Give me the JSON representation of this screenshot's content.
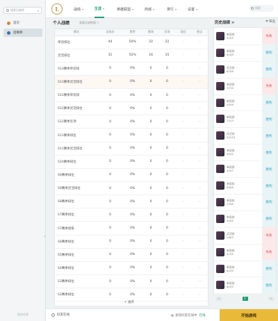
{
  "sidebar": {
    "search_placeholder": "搜索召唤师",
    "items": [
      {
        "label": "首页",
        "icon": "home-icon",
        "color": "#d4843b"
      },
      {
        "label": "召唤师",
        "icon": "user-icon",
        "color": "#3a6fb0"
      }
    ],
    "footer": "版本信息"
  },
  "nav": {
    "items": [
      {
        "label": "战绩",
        "active": false,
        "dropdown": true
      },
      {
        "label": "生涯",
        "active": true,
        "dropdown": true
      },
      {
        "label": "英雄联盟",
        "active": false,
        "dropdown": true
      },
      {
        "label": "商城",
        "active": false,
        "dropdown": true
      },
      {
        "label": "排行",
        "active": false,
        "dropdown": true
      },
      {
        "label": "设置",
        "active": false,
        "dropdown": true
      }
    ],
    "search_placeholder": "搜索"
  },
  "stats": {
    "title": "个人战绩",
    "subtitle": "查看全部数据 >",
    "columns": [
      "模式",
      "总场次",
      "胜率",
      "胜场",
      "负场",
      "段位",
      "胜点"
    ],
    "rows": [
      {
        "name": "单双排位",
        "games": "44",
        "winrate": "50%",
        "wins": "22",
        "losses": "22",
        "tier": "—",
        "lp": "—"
      },
      {
        "name": "灵活排位",
        "games": "31",
        "winrate": "52%",
        "wins": "16",
        "losses": "15",
        "tier": "—",
        "lp": "—"
      },
      {
        "name": "S13赛季单双排",
        "games": "0",
        "winrate": "0%",
        "wins": "0",
        "losses": "0",
        "tier": "—",
        "lp": "—"
      },
      {
        "name": "S13赛季灵活排位",
        "games": "0",
        "winrate": "0%",
        "wins": "0",
        "losses": "0",
        "tier": "—",
        "lp": "—"
      },
      {
        "name": "S12赛季单双排",
        "games": "0",
        "winrate": "0%",
        "wins": "0",
        "losses": "0",
        "tier": "—",
        "lp": "—"
      },
      {
        "name": "S12赛季灵活排位",
        "games": "0",
        "winrate": "0%",
        "wins": "0",
        "losses": "0",
        "tier": "—",
        "lp": "—"
      },
      {
        "name": "S12赛季云顶",
        "games": "0",
        "winrate": "0%",
        "wins": "0",
        "losses": "0",
        "tier": "—",
        "lp": "—"
      },
      {
        "name": "S11赛季排位",
        "games": "0",
        "winrate": "0%",
        "wins": "0",
        "losses": "0",
        "tier": "—",
        "lp": "—"
      },
      {
        "name": "S11赛季灵活排位",
        "games": "0",
        "winrate": "0%",
        "wins": "0",
        "losses": "0",
        "tier": "—",
        "lp": "—"
      },
      {
        "name": "S10赛季排位",
        "games": "0",
        "winrate": "0%",
        "wins": "0",
        "losses": "0",
        "tier": "—",
        "lp": "—"
      },
      {
        "name": "S9赛季排位",
        "games": "0",
        "winrate": "0%",
        "wins": "0",
        "losses": "0",
        "tier": "—",
        "lp": "—"
      },
      {
        "name": "S9赛季灵活排位",
        "games": "0",
        "winrate": "0%",
        "wins": "0",
        "losses": "0",
        "tier": "—",
        "lp": "—"
      },
      {
        "name": "S8赛季排位",
        "games": "0",
        "winrate": "0%",
        "wins": "0",
        "losses": "0",
        "tier": "—",
        "lp": "—"
      },
      {
        "name": "S7赛季排位",
        "games": "0",
        "winrate": "0%",
        "wins": "0",
        "losses": "0",
        "tier": "—",
        "lp": "—"
      },
      {
        "name": "S7赛季组排",
        "games": "0",
        "winrate": "0%",
        "wins": "0",
        "losses": "0",
        "tier": "—",
        "lp": "—"
      },
      {
        "name": "S6赛季排位",
        "games": "0",
        "winrate": "0%",
        "wins": "0",
        "losses": "0",
        "tier": "—",
        "lp": "—"
      },
      {
        "name": "S5赛季排位",
        "games": "0",
        "winrate": "0%",
        "wins": "0",
        "losses": "0",
        "tier": "—",
        "lp": "—"
      },
      {
        "name": "S4赛季排位",
        "games": "0",
        "winrate": "0%",
        "wins": "0",
        "losses": "0",
        "tier": "—",
        "lp": "—"
      },
      {
        "name": "S3赛季排位",
        "games": "0",
        "winrate": "0%",
        "wins": "0",
        "losses": "0",
        "tier": "—",
        "lp": "—"
      },
      {
        "name": "S2赛季排位",
        "games": "0",
        "winrate": "0%",
        "wins": "0",
        "losses": "0",
        "tier": "—",
        "lp": "—"
      }
    ],
    "more_label": "+ 展开"
  },
  "history": {
    "title": "历史战绩 >",
    "filter_label": "筛选",
    "matches": [
      {
        "mode": "单双排",
        "kda": "3/2/5",
        "result": "失败",
        "win": false
      },
      {
        "mode": "单双排",
        "kda": "6/4/8",
        "result": "胜利",
        "win": true
      },
      {
        "mode": "灵活排",
        "kda": "8/3/6",
        "result": "胜利",
        "win": true
      },
      {
        "mode": "单双排",
        "kda": "2/7/4",
        "result": "失败",
        "win": false
      },
      {
        "mode": "单双排",
        "kda": "4/5/9",
        "result": "胜利",
        "win": true
      },
      {
        "mode": "单双排",
        "kda": "7/1/3",
        "result": "胜利",
        "win": true
      },
      {
        "mode": "灵活排",
        "kda": "5/2/10",
        "result": "胜利",
        "win": true
      },
      {
        "mode": "单双排",
        "kda": "9/4/2",
        "result": "胜利",
        "win": true
      },
      {
        "mode": "单双排",
        "kda": "3/3/7",
        "result": "胜利",
        "win": true
      },
      {
        "mode": "单双排",
        "kda": "6/6/6",
        "result": "胜利",
        "win": true
      },
      {
        "mode": "单双排",
        "kda": "1/5/8",
        "result": "胜利",
        "win": true
      },
      {
        "mode": "单双排",
        "kda": "4/4/4",
        "result": "胜利",
        "win": true
      },
      {
        "mode": "灵活排",
        "kda": "2/6/3",
        "result": "失败",
        "win": false
      },
      {
        "mode": "单双排",
        "kda": "5/7/2",
        "result": "失败",
        "win": false
      },
      {
        "mode": "单双排",
        "kda": "8/2/9",
        "result": "胜利",
        "win": true
      },
      {
        "mode": "单双排",
        "kda": "6/3/5",
        "result": "胜利",
        "win": true
      }
    ],
    "pages": [
      "<",
      "1",
      ">"
    ]
  },
  "bottom": {
    "friends_label": "好友在线",
    "status_label": "发现好友在线中",
    "status_tag": "在线",
    "play_label": "开始游戏"
  }
}
